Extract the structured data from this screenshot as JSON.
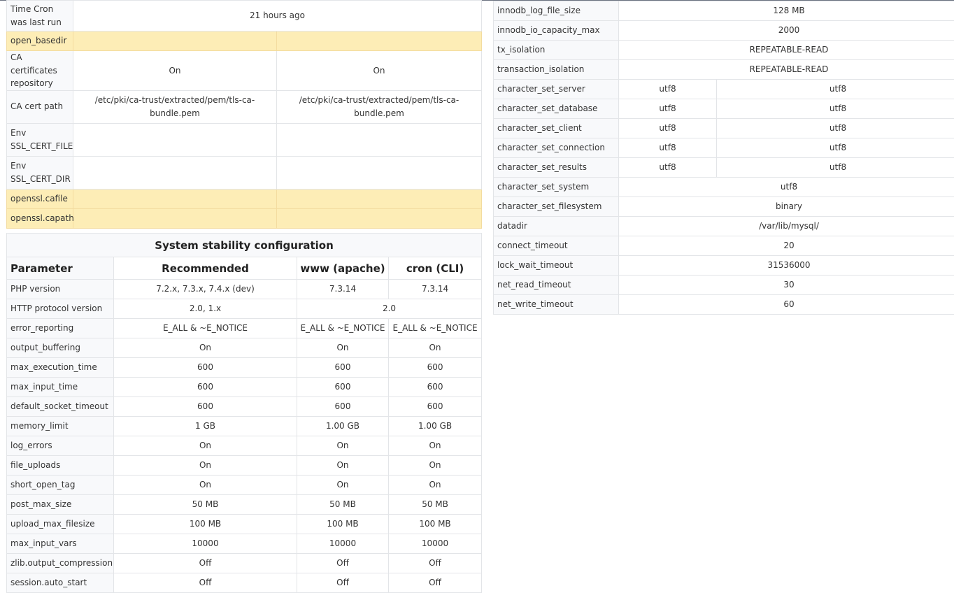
{
  "top_table": {
    "rows": [
      {
        "label": "Time Cron was last run",
        "values": [
          "21 hours ago"
        ],
        "merged": true,
        "highlight": false
      },
      {
        "label": "open_basedir",
        "values": [
          "",
          ""
        ],
        "merged": false,
        "highlight": true
      },
      {
        "label": "CA certificates repository",
        "values": [
          "On",
          "On"
        ],
        "merged": false,
        "highlight": false
      },
      {
        "label": "CA cert path",
        "values": [
          "/etc/pki/ca-trust/extracted/pem/tls-ca-bundle.pem",
          "/etc/pki/ca-trust/extracted/pem/tls-ca-bundle.pem"
        ],
        "merged": false,
        "highlight": false
      },
      {
        "label": "Env SSL_CERT_FILE",
        "values": [
          "",
          ""
        ],
        "merged": false,
        "highlight": false
      },
      {
        "label": "Env SSL_CERT_DIR",
        "values": [
          "",
          ""
        ],
        "merged": false,
        "highlight": false
      },
      {
        "label": "openssl.cafile",
        "values": [
          "",
          ""
        ],
        "merged": false,
        "highlight": true
      },
      {
        "label": "openssl.capath",
        "values": [
          "",
          ""
        ],
        "merged": false,
        "highlight": true
      }
    ]
  },
  "stability": {
    "title": "System stability configuration",
    "headers": [
      "Parameter",
      "Recommended",
      "www (apache)",
      "cron (CLI)"
    ],
    "rows": [
      {
        "param": "PHP version",
        "recommended": "7.2.x, 7.3.x, 7.4.x (dev)",
        "www": "7.3.14",
        "cron": "7.3.14"
      },
      {
        "param": "HTTP protocol version",
        "recommended": "2.0, 1.x",
        "www": "2.0",
        "cron": null
      },
      {
        "param": "error_reporting",
        "recommended": "E_ALL & ~E_NOTICE",
        "www": "E_ALL & ~E_NOTICE",
        "cron": "E_ALL & ~E_NOTICE"
      },
      {
        "param": "output_buffering",
        "recommended": "On",
        "www": "On",
        "cron": "On"
      },
      {
        "param": "max_execution_time",
        "recommended": "600",
        "www": "600",
        "cron": "600"
      },
      {
        "param": "max_input_time",
        "recommended": "600",
        "www": "600",
        "cron": "600"
      },
      {
        "param": "default_socket_timeout",
        "recommended": "600",
        "www": "600",
        "cron": "600"
      },
      {
        "param": "memory_limit",
        "recommended": "1 GB",
        "www": "1.00 GB",
        "cron": "1.00 GB"
      },
      {
        "param": "log_errors",
        "recommended": "On",
        "www": "On",
        "cron": "On"
      },
      {
        "param": "file_uploads",
        "recommended": "On",
        "www": "On",
        "cron": "On"
      },
      {
        "param": "short_open_tag",
        "recommended": "On",
        "www": "On",
        "cron": "On"
      },
      {
        "param": "post_max_size",
        "recommended": "50 MB",
        "www": "50 MB",
        "cron": "50 MB"
      },
      {
        "param": "upload_max_filesize",
        "recommended": "100 MB",
        "www": "100 MB",
        "cron": "100 MB"
      },
      {
        "param": "max_input_vars",
        "recommended": "10000",
        "www": "10000",
        "cron": "10000"
      },
      {
        "param": "zlib.output_compression",
        "recommended": "Off",
        "www": "Off",
        "cron": "Off"
      },
      {
        "param": "session.auto_start",
        "recommended": "Off",
        "www": "Off",
        "cron": "Off"
      }
    ]
  },
  "mysql": {
    "rows": [
      {
        "label": "innodb_log_file_size",
        "values": [
          "128 MB"
        ]
      },
      {
        "label": "innodb_io_capacity_max",
        "values": [
          "2000"
        ]
      },
      {
        "label": "tx_isolation",
        "values": [
          "REPEATABLE-READ"
        ]
      },
      {
        "label": "transaction_isolation",
        "values": [
          "REPEATABLE-READ"
        ]
      },
      {
        "label": "character_set_server",
        "values": [
          "utf8",
          "utf8"
        ]
      },
      {
        "label": "character_set_database",
        "values": [
          "utf8",
          "utf8"
        ]
      },
      {
        "label": "character_set_client",
        "values": [
          "utf8",
          "utf8"
        ]
      },
      {
        "label": "character_set_connection",
        "values": [
          "utf8",
          "utf8"
        ]
      },
      {
        "label": "character_set_results",
        "values": [
          "utf8",
          "utf8"
        ]
      },
      {
        "label": "character_set_system",
        "values": [
          "utf8"
        ]
      },
      {
        "label": "character_set_filesystem",
        "values": [
          "binary"
        ]
      },
      {
        "label": "datadir",
        "values": [
          "/var/lib/mysql/"
        ]
      },
      {
        "label": "connect_timeout",
        "values": [
          "20"
        ]
      },
      {
        "label": "lock_wait_timeout",
        "values": [
          "31536000"
        ]
      },
      {
        "label": "net_read_timeout",
        "values": [
          "30"
        ]
      },
      {
        "label": "net_write_timeout",
        "values": [
          "60"
        ]
      }
    ]
  }
}
